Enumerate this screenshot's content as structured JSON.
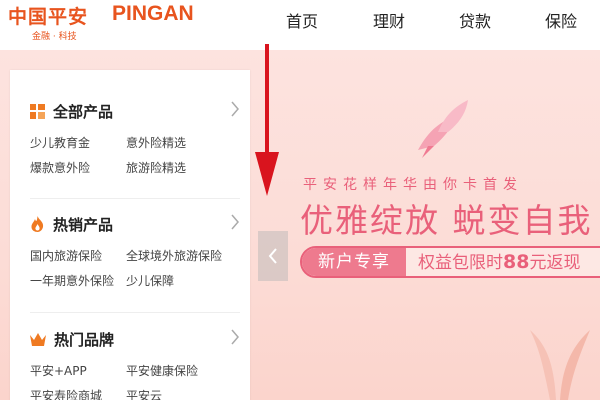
{
  "header": {
    "logo_cn": "中国平安",
    "logo_en": "PINGAN",
    "logo_sub": "金融 · 科技",
    "nav": [
      "首页",
      "理财",
      "贷款",
      "保险"
    ]
  },
  "banner": {
    "line1": "平安花样年华由你卡首发",
    "line2": "优雅绽放 蜕变自我",
    "promo_tag": "新户专享",
    "promo_pre": "权益包限时",
    "promo_num": "88",
    "promo_post": "元返现"
  },
  "sidemenu": {
    "sections": [
      {
        "title": "全部产品",
        "icon": "grid-icon",
        "items": [
          "少儿教育金",
          "意外险精选",
          "爆款意外险",
          "旅游险精选"
        ]
      },
      {
        "title": "热销产品",
        "icon": "flame-icon",
        "items": [
          "国内旅游保险",
          "全球境外旅游保险",
          "一年期意外保险",
          "少儿保障"
        ]
      },
      {
        "title": "热门品牌",
        "icon": "crown-icon",
        "items": [
          "平安+APP",
          "平安健康保险",
          "平安寿险商城",
          "平安云"
        ]
      }
    ]
  },
  "colors": {
    "brand_orange": "#e8541e",
    "banner_pink": "#e9607a",
    "arrow_red": "#d9141e"
  }
}
